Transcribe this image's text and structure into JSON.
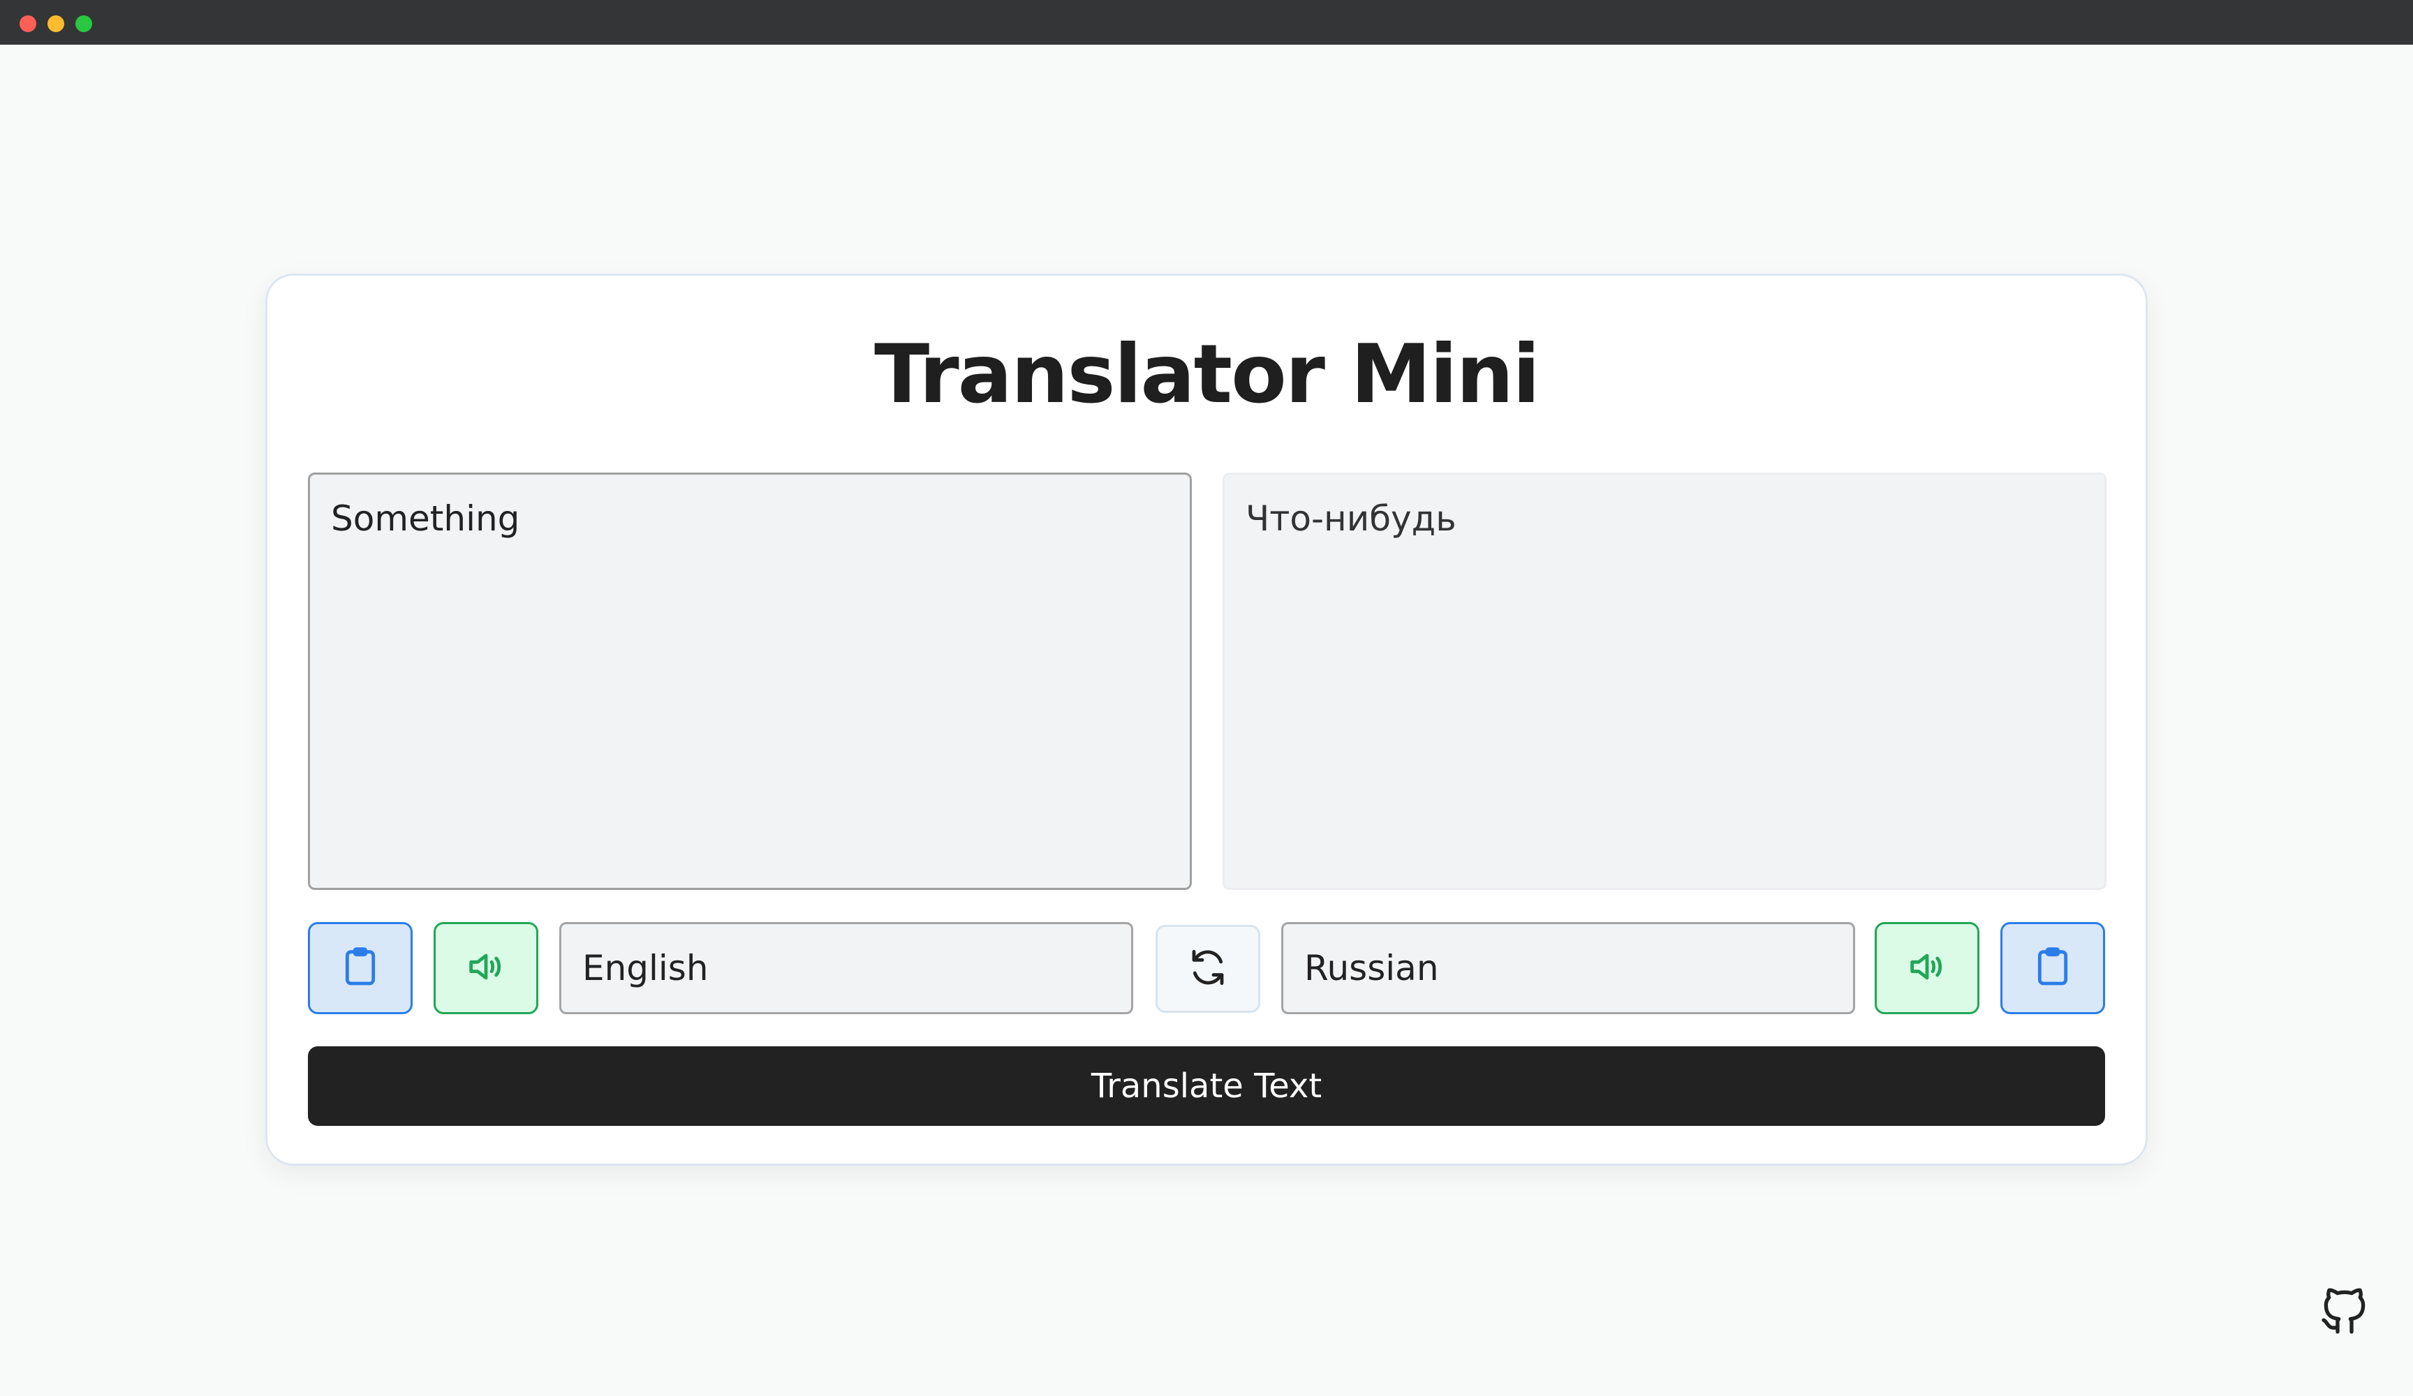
{
  "app": {
    "title": "Translator Mini"
  },
  "source": {
    "text": "Something",
    "language": "English"
  },
  "target": {
    "text": "Что-нибудь",
    "language": "Russian"
  },
  "actions": {
    "translate_label": "Translate Text"
  },
  "icons": {
    "copy": "clipboard-icon",
    "speak": "speaker-icon",
    "swap": "swap-icon",
    "github": "github-icon"
  },
  "colors": {
    "copy_accent": "#2b7de9",
    "speak_accent": "#22a658",
    "primary_button": "#222222",
    "background": "#f8f9f9"
  }
}
